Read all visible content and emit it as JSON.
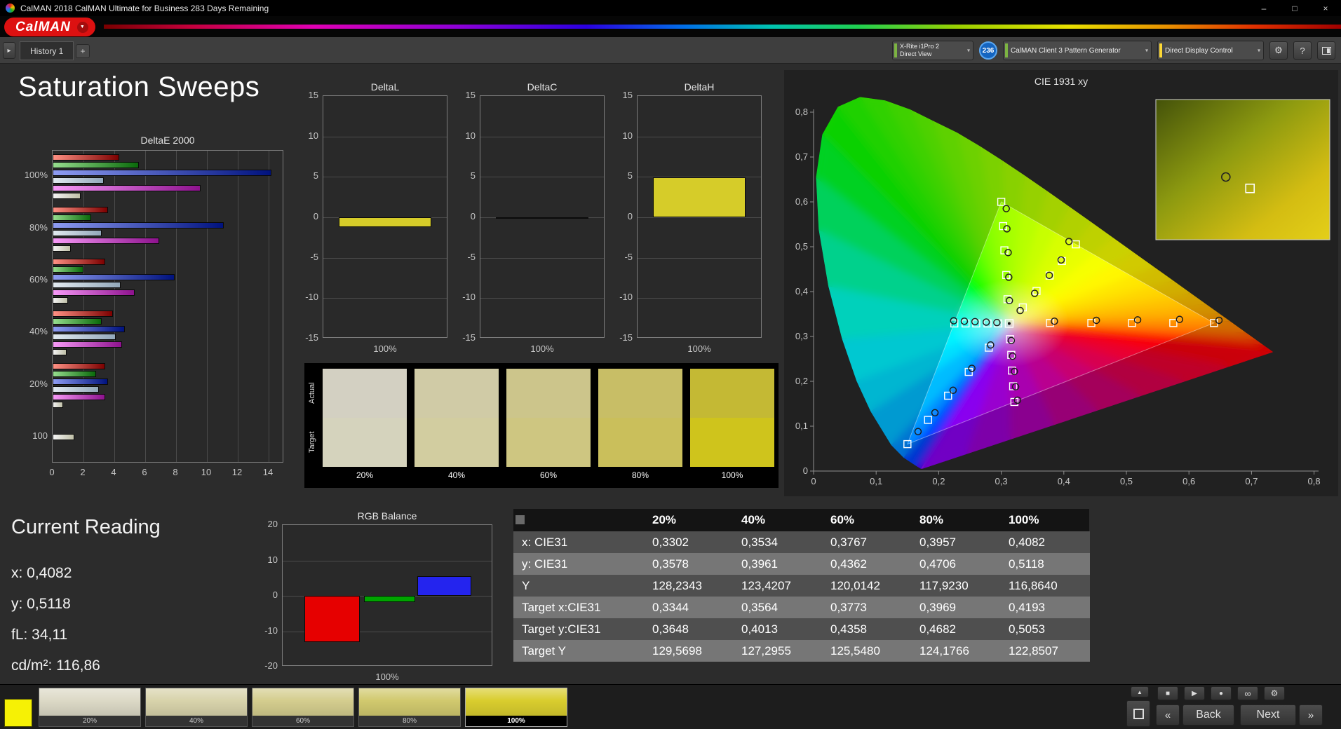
{
  "window": {
    "title": "CalMAN 2018 CalMAN Ultimate for Business 283 Days Remaining",
    "minimize": "–",
    "maximize": "□",
    "close": "×"
  },
  "brand": {
    "logo_text": "CalMAN",
    "chevron": "▼"
  },
  "toolbar": {
    "nav_icon": "▸",
    "history_tab": "History 1",
    "add_tab": "+",
    "meter_line1": "X-Rite i1Pro 2",
    "meter_line2": "Direct View",
    "badge": "236",
    "pattern_generator": "CalMAN Client 3 Pattern Generator",
    "display_control": "Direct Display Control",
    "gear_icon": "⚙",
    "help_icon": "?",
    "dropdown_icon": "▾"
  },
  "page_title": "Saturation Sweeps",
  "current_reading": {
    "title": "Current Reading",
    "x": "x: 0,4082",
    "y": "y: 0,5118",
    "fl": "fL: 34,11",
    "cdm2": "cd/m²: 116,86"
  },
  "swatch_strip": {
    "row_labels": [
      "Actual",
      "Target"
    ],
    "labels": [
      "20%",
      "40%",
      "60%",
      "80%",
      "100%"
    ],
    "actual": [
      "#d3d0c2",
      "#d0cba6",
      "#ccc58b",
      "#c8be66",
      "#c4b934"
    ],
    "target": [
      "#d5d3bd",
      "#d2cda0",
      "#cec681",
      "#cabf5b",
      "#cfc41c"
    ]
  },
  "bottom_bar": {
    "color_patch": "#f6f105",
    "patches": [
      {
        "label": "20%",
        "color": "#dcd9c6"
      },
      {
        "label": "40%",
        "color": "#d8d3ab"
      },
      {
        "label": "60%",
        "color": "#d4cd8e"
      },
      {
        "label": "80%",
        "color": "#d1c96e"
      },
      {
        "label": "100%",
        "color": "#d9cd2e"
      }
    ],
    "selected_index": 4,
    "up_icon": "▲",
    "stop_icon": "■",
    "play_icon": "▶",
    "record_icon": "●",
    "loop_icon": "∞",
    "settings_icon": "⚙",
    "prev_icon": "«",
    "next_icon": "»",
    "back_label": "Back",
    "next_label": "Next"
  },
  "chart_data": [
    {
      "id": "deltae2000",
      "type": "bar",
      "orientation": "horizontal",
      "title": "DeltaE 2000",
      "categories": [
        "100%",
        "80%",
        "60%",
        "40%",
        "20%",
        "100"
      ],
      "series": [
        {
          "name": "red",
          "values": [
            4.3,
            3.6,
            3.4,
            3.9,
            3.4,
            null
          ]
        },
        {
          "name": "green",
          "values": [
            5.6,
            2.5,
            2.0,
            3.2,
            2.8,
            null
          ]
        },
        {
          "name": "blue",
          "values": [
            14.2,
            11.1,
            7.9,
            4.7,
            3.6,
            null
          ]
        },
        {
          "name": "cyan",
          "values": [
            3.3,
            3.2,
            4.4,
            4.1,
            3.0,
            null
          ]
        },
        {
          "name": "magenta",
          "values": [
            9.6,
            6.9,
            5.3,
            4.5,
            3.4,
            null
          ]
        },
        {
          "name": "white",
          "values": [
            1.8,
            1.2,
            1.0,
            0.9,
            0.7,
            1.4
          ]
        }
      ],
      "colors": {
        "red": [
          "#ff9184",
          "#7c0000"
        ],
        "green": [
          "#96dd8e",
          "#0a6a0a"
        ],
        "blue": [
          "#8e9cf2",
          "#00127e"
        ],
        "cyan": [
          "#e2eaf0",
          "#93a9bb"
        ],
        "magenta": [
          "#f79af7",
          "#8e128e"
        ],
        "white": [
          "#f4f4f4",
          "#c0c0a8"
        ]
      },
      "xticks": [
        0,
        2,
        4,
        6,
        8,
        10,
        12,
        14
      ],
      "xlim": [
        0,
        15
      ]
    },
    {
      "id": "deltaL",
      "type": "bar",
      "title": "DeltaL",
      "categories": [
        "100%"
      ],
      "values": [
        -1.2
      ],
      "yticks": [
        15,
        10,
        5,
        0,
        -5,
        -10,
        -15
      ],
      "ylim": [
        -15,
        15
      ],
      "bar_color": "#d6cc29"
    },
    {
      "id": "deltaC",
      "type": "bar",
      "title": "DeltaC",
      "categories": [
        "100%"
      ],
      "values": [
        -0.15
      ],
      "yticks": [
        15,
        10,
        5,
        0,
        -5,
        -10,
        -15
      ],
      "ylim": [
        -15,
        15
      ],
      "bar_color": "#d6cc29"
    },
    {
      "id": "deltaH",
      "type": "bar",
      "title": "DeltaH",
      "categories": [
        "100%"
      ],
      "values": [
        4.95
      ],
      "yticks": [
        15,
        10,
        5,
        0,
        -5,
        -10,
        -15
      ],
      "ylim": [
        -15,
        15
      ],
      "bar_color": "#d6cc29"
    },
    {
      "id": "rgbbalance",
      "type": "bar",
      "title": "RGB Balance",
      "categories": [
        "100%"
      ],
      "series": [
        {
          "name": "red",
          "value": -13,
          "color": "#e60000"
        },
        {
          "name": "green",
          "value": -1.8,
          "color": "#00a400"
        },
        {
          "name": "blue",
          "value": 5.5,
          "color": "#2424ee"
        }
      ],
      "yticks": [
        20,
        10,
        0,
        -10,
        -20
      ],
      "ylim": [
        -20,
        20
      ]
    },
    {
      "id": "cie",
      "type": "scatter",
      "title": "CIE 1931 xy",
      "xlim": [
        0,
        0.8
      ],
      "ylim": [
        0,
        0.8
      ],
      "ticks": [
        "0",
        "0,1",
        "0,2",
        "0,3",
        "0,4",
        "0,5",
        "0,6",
        "0,7",
        "0,8"
      ],
      "white_point": [
        0.3127,
        0.329
      ],
      "gamut_triangle": [
        [
          0.64,
          0.33
        ],
        [
          0.3,
          0.6
        ],
        [
          0.15,
          0.06
        ]
      ],
      "targets": [
        [
          0.378,
          0.33
        ],
        [
          0.444,
          0.33
        ],
        [
          0.509,
          0.33
        ],
        [
          0.575,
          0.33
        ],
        [
          0.64,
          0.33
        ],
        [
          0.31,
          0.383
        ],
        [
          0.308,
          0.437
        ],
        [
          0.305,
          0.492
        ],
        [
          0.303,
          0.546
        ],
        [
          0.3,
          0.6
        ],
        [
          0.28,
          0.275
        ],
        [
          0.248,
          0.221
        ],
        [
          0.215,
          0.168
        ],
        [
          0.183,
          0.114
        ],
        [
          0.15,
          0.06
        ],
        [
          0.295,
          0.329
        ],
        [
          0.278,
          0.329
        ],
        [
          0.26,
          0.329
        ],
        [
          0.243,
          0.329
        ],
        [
          0.225,
          0.329
        ],
        [
          0.314,
          0.294
        ],
        [
          0.316,
          0.259
        ],
        [
          0.317,
          0.224
        ],
        [
          0.319,
          0.189
        ],
        [
          0.321,
          0.154
        ],
        [
          0.3344,
          0.3648
        ],
        [
          0.3564,
          0.4013
        ],
        [
          0.3773,
          0.4358
        ],
        [
          0.3969,
          0.4682
        ],
        [
          0.4193,
          0.5053
        ]
      ],
      "measurements": [
        [
          0.385,
          0.334
        ],
        [
          0.452,
          0.336
        ],
        [
          0.518,
          0.337
        ],
        [
          0.585,
          0.338
        ],
        [
          0.648,
          0.336
        ],
        [
          0.313,
          0.38
        ],
        [
          0.312,
          0.432
        ],
        [
          0.311,
          0.487
        ],
        [
          0.309,
          0.54
        ],
        [
          0.308,
          0.585
        ],
        [
          0.283,
          0.281
        ],
        [
          0.253,
          0.229
        ],
        [
          0.223,
          0.18
        ],
        [
          0.194,
          0.13
        ],
        [
          0.167,
          0.088
        ],
        [
          0.293,
          0.331
        ],
        [
          0.276,
          0.332
        ],
        [
          0.258,
          0.333
        ],
        [
          0.241,
          0.334
        ],
        [
          0.224,
          0.335
        ],
        [
          0.316,
          0.291
        ],
        [
          0.318,
          0.256
        ],
        [
          0.321,
          0.222
        ],
        [
          0.323,
          0.188
        ],
        [
          0.326,
          0.158
        ],
        [
          0.3302,
          0.3578
        ],
        [
          0.3534,
          0.3961
        ],
        [
          0.3767,
          0.4362
        ],
        [
          0.3957,
          0.4706
        ],
        [
          0.4082,
          0.5118
        ]
      ],
      "inset": {
        "x0": 0.376,
        "x1": 0.456,
        "y_top": 0.556,
        "y_bottom": 0.476,
        "target": [
          0.4193,
          0.5053
        ],
        "measurement": [
          0.4082,
          0.5118
        ]
      }
    },
    {
      "id": "results-table",
      "type": "table",
      "columns": [
        "",
        "20%",
        "40%",
        "60%",
        "80%",
        "100%"
      ],
      "rows": [
        {
          "label": "x: CIE31",
          "values": [
            "0,3302",
            "0,3534",
            "0,3767",
            "0,3957",
            "0,4082"
          ]
        },
        {
          "label": "y: CIE31",
          "values": [
            "0,3578",
            "0,3961",
            "0,4362",
            "0,4706",
            "0,5118"
          ]
        },
        {
          "label": "Y",
          "values": [
            "128,2343",
            "123,4207",
            "120,0142",
            "117,9230",
            "116,8640"
          ]
        },
        {
          "label": "Target x:CIE31",
          "values": [
            "0,3344",
            "0,3564",
            "0,3773",
            "0,3969",
            "0,4193"
          ]
        },
        {
          "label": "Target y:CIE31",
          "values": [
            "0,3648",
            "0,4013",
            "0,4358",
            "0,4682",
            "0,5053"
          ]
        },
        {
          "label": "Target Y",
          "values": [
            "129,5698",
            "127,2955",
            "125,5480",
            "124,1766",
            "122,8507"
          ]
        }
      ]
    }
  ]
}
